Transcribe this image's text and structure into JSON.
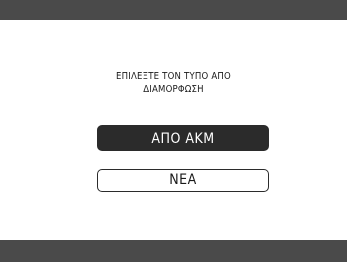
{
  "dialog": {
    "prompt_line1": "ΕΠΙΛΕΞΤΕ ΤΟΝ ΤΥΠΟ ΑΠΟ",
    "prompt_line2": "ΔΙΑΜΟΡΦΩΣΗ"
  },
  "options": [
    {
      "label": "ΑΠΟ ΑΚΜ",
      "selected": true
    },
    {
      "label": "ΝΕΑ",
      "selected": false
    }
  ],
  "colors": {
    "bar": "#4a4a4a",
    "selected_bg": "#2b2b2b",
    "background": "#ffffff"
  }
}
